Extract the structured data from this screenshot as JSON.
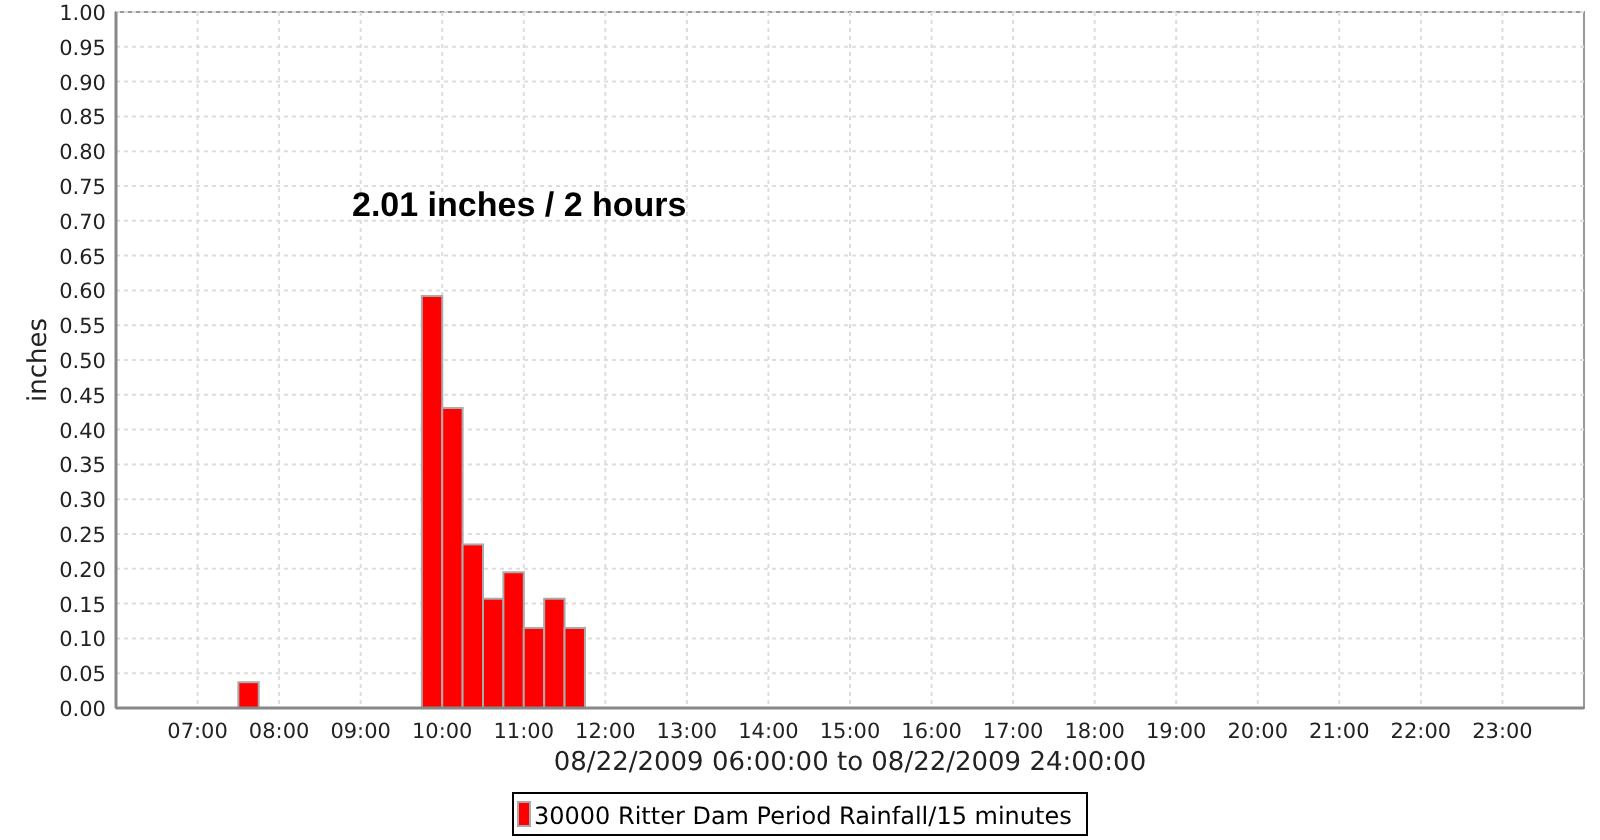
{
  "chart_data": {
    "type": "bar",
    "xlabel": "08/22/2009 06:00:00 to 08/22/2009 24:00:00",
    "ylabel": "inches",
    "x": [
      7.625,
      9.875,
      10.125,
      10.375,
      10.625,
      10.875,
      11.125,
      11.375,
      11.625
    ],
    "series": [
      {
        "name": "30000 Ritter Dam Period Rainfall/15 minutes",
        "color": "#ff0000",
        "values": [
          0.037,
          0.592,
          0.431,
          0.235,
          0.157,
          0.195,
          0.115,
          0.157,
          0.115
        ]
      }
    ],
    "xlim": [
      6,
      24
    ],
    "ylim": [
      0,
      1
    ],
    "xticks": [
      {
        "value": 7,
        "label": "07:00"
      },
      {
        "value": 8,
        "label": "08:00"
      },
      {
        "value": 9,
        "label": "09:00"
      },
      {
        "value": 10,
        "label": "10:00"
      },
      {
        "value": 11,
        "label": "11:00"
      },
      {
        "value": 12,
        "label": "12:00"
      },
      {
        "value": 13,
        "label": "13:00"
      },
      {
        "value": 14,
        "label": "14:00"
      },
      {
        "value": 15,
        "label": "15:00"
      },
      {
        "value": 16,
        "label": "16:00"
      },
      {
        "value": 17,
        "label": "17:00"
      },
      {
        "value": 18,
        "label": "18:00"
      },
      {
        "value": 19,
        "label": "19:00"
      },
      {
        "value": 20,
        "label": "20:00"
      },
      {
        "value": 21,
        "label": "21:00"
      },
      {
        "value": 22,
        "label": "22:00"
      },
      {
        "value": 23,
        "label": "23:00"
      }
    ],
    "yticks": [
      {
        "value": 0,
        "label": "0.00"
      },
      {
        "value": 0.05,
        "label": "0.05"
      },
      {
        "value": 0.1,
        "label": "0.10"
      },
      {
        "value": 0.15,
        "label": "0.15"
      },
      {
        "value": 0.2,
        "label": "0.20"
      },
      {
        "value": 0.25,
        "label": "0.25"
      },
      {
        "value": 0.3,
        "label": "0.30"
      },
      {
        "value": 0.35,
        "label": "0.35"
      },
      {
        "value": 0.4,
        "label": "0.40"
      },
      {
        "value": 0.45,
        "label": "0.45"
      },
      {
        "value": 0.5,
        "label": "0.50"
      },
      {
        "value": 0.55,
        "label": "0.55"
      },
      {
        "value": 0.6,
        "label": "0.60"
      },
      {
        "value": 0.65,
        "label": "0.65"
      },
      {
        "value": 0.7,
        "label": "0.70"
      },
      {
        "value": 0.75,
        "label": "0.75"
      },
      {
        "value": 0.8,
        "label": "0.80"
      },
      {
        "value": 0.85,
        "label": "0.85"
      },
      {
        "value": 0.9,
        "label": "0.90"
      },
      {
        "value": 0.95,
        "label": "0.95"
      },
      {
        "value": 1,
        "label": "1.00"
      }
    ],
    "grid": true,
    "annotations": [
      "2.01 inches / 2 hours"
    ]
  }
}
